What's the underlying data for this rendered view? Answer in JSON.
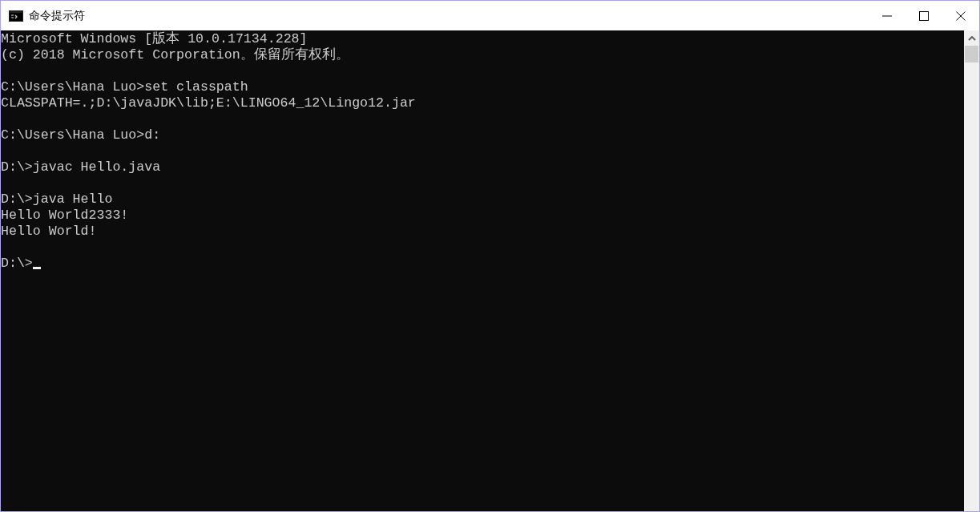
{
  "window": {
    "title": "命令提示符"
  },
  "console": {
    "blocks": [
      [
        "Microsoft Windows [版本 10.0.17134.228]",
        "(c) 2018 Microsoft Corporation。保留所有权利。"
      ],
      [
        "C:\\Users\\Hana Luo>set classpath",
        "CLASSPATH=.;D:\\javaJDK\\lib;E:\\LINGO64_12\\Lingo12.jar"
      ],
      [
        "C:\\Users\\Hana Luo>d:"
      ],
      [
        "D:\\>javac Hello.java"
      ],
      [
        "D:\\>java Hello",
        "Hello World2333!",
        "Hello World!"
      ]
    ],
    "prompt": {
      "text": "D:\\>",
      "cursor": true
    }
  }
}
